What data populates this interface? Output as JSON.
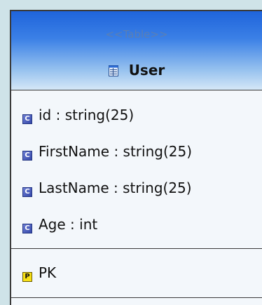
{
  "diagram": {
    "stereotype": "<<Table>>",
    "class_name": "User",
    "table_icon": "table-icon",
    "attributes": [
      {
        "text": "id : string(25)",
        "icon": "column-icon",
        "icon_letter": "C"
      },
      {
        "text": "FirstName : string(25)",
        "icon": "column-icon",
        "icon_letter": "C"
      },
      {
        "text": "LastName : string(25)",
        "icon": "column-icon",
        "icon_letter": "C"
      },
      {
        "text": "Age : int",
        "icon": "column-icon",
        "icon_letter": "C"
      }
    ],
    "keys": [
      {
        "text": "PK",
        "icon": "primary-key-icon",
        "icon_letter": "P"
      }
    ]
  },
  "colors": {
    "header_top": "#1f64db",
    "header_bottom": "#d5e7f7",
    "background": "#cfe3e8",
    "column_icon": "#3548a8",
    "key_icon": "#f7e016"
  }
}
